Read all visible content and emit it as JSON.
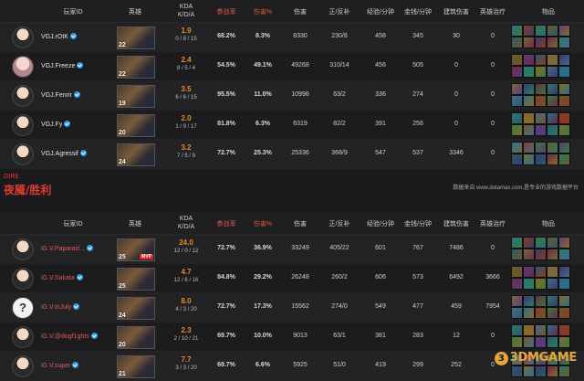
{
  "headers": {
    "player_id": "玩家ID",
    "hero": "英雄",
    "kda_top": "KDA",
    "kda_bottom": "K/D/A",
    "participation": "参战率",
    "damage_pct": "伤害%",
    "damage": "伤害",
    "last_hits": "正/反补",
    "xpm": "经验/分钟",
    "gpm": "金钱/分钟",
    "building_damage": "建筑伤害",
    "hero_healing": "英雄治疗",
    "items": "物品"
  },
  "radiant": {
    "players": [
      {
        "name": "VGJ.rOtK",
        "level": "22",
        "ratio": "1.9",
        "kda": "0 / 8 / 15",
        "participation": "68.2%",
        "damage_pct": "8.3%",
        "damage": "8330",
        "last_hits": "230/8",
        "xpm": "458",
        "gpm": "345",
        "building_damage": "30",
        "hero_healing": "0",
        "avatar": "player-photo-icon"
      },
      {
        "name": "VGJ.Freeze",
        "level": "22",
        "ratio": "2.4",
        "kda": "8 / 5 / 4",
        "participation": "54.5%",
        "damage_pct": "49.1%",
        "damage": "49268",
        "last_hits": "310/14",
        "xpm": "456",
        "gpm": "505",
        "building_damage": "0",
        "hero_healing": "0",
        "avatar": "player-photo-icon"
      },
      {
        "name": "VGJ.Fenrir",
        "level": "19",
        "ratio": "3.5",
        "kda": "6 / 6 / 15",
        "participation": "95.5%",
        "damage_pct": "11.0%",
        "damage": "10998",
        "last_hits": "63/2",
        "xpm": "336",
        "gpm": "274",
        "building_damage": "0",
        "hero_healing": "0",
        "avatar": "player-photo-icon"
      },
      {
        "name": "VGJ.Fy",
        "level": "20",
        "ratio": "2.0",
        "kda": "1 / 9 / 17",
        "participation": "81.8%",
        "damage_pct": "6.3%",
        "damage": "6319",
        "last_hits": "82/2",
        "xpm": "391",
        "gpm": "256",
        "building_damage": "0",
        "hero_healing": "0",
        "avatar": "player-photo-icon"
      },
      {
        "name": "VGJ.Agressif",
        "level": "24",
        "ratio": "3.2",
        "kda": "7 / 5 / 9",
        "participation": "72.7%",
        "damage_pct": "25.3%",
        "damage": "25336",
        "last_hits": "368/9",
        "xpm": "547",
        "gpm": "537",
        "building_damage": "3346",
        "hero_healing": "0",
        "avatar": "player-photo-icon"
      }
    ]
  },
  "dire_label": "DIRE",
  "dire_result": "夜魇/胜利",
  "source_note": "数据来自 www.dotamax.com,是专业的游戏数据平台",
  "dire": {
    "players": [
      {
        "name": "iG.V.Paparazi...",
        "level": "25",
        "ratio": "24.0",
        "kda": "12 / 0 / 12",
        "participation": "72.7%",
        "damage_pct": "36.9%",
        "damage": "33249",
        "last_hits": "405/22",
        "xpm": "601",
        "gpm": "767",
        "building_damage": "7486",
        "hero_healing": "0",
        "mvp": "MVP",
        "avatar": "player-photo-icon"
      },
      {
        "name": "iG.V.Sakata",
        "level": "25",
        "ratio": "4.7",
        "kda": "12 / 6 / 16",
        "participation": "84.8%",
        "damage_pct": "29.2%",
        "damage": "26248",
        "last_hits": "260/2",
        "xpm": "606",
        "gpm": "573",
        "building_damage": "6492",
        "hero_healing": "3666",
        "avatar": "player-photo-icon"
      },
      {
        "name": "iG.V.InJuly",
        "level": "24",
        "ratio": "8.0",
        "kda": "4 / 3 / 20",
        "participation": "72.7%",
        "damage_pct": "17.3%",
        "damage": "15562",
        "last_hits": "274/0",
        "xpm": "549",
        "gpm": "477",
        "building_damage": "459",
        "hero_healing": "7954",
        "avatar": "question-mark-icon"
      },
      {
        "name": "iG.V.@dogf1ghts",
        "level": "20",
        "ratio": "2.3",
        "kda": "2 / 10 / 21",
        "participation": "69.7%",
        "damage_pct": "10.0%",
        "damage": "9013",
        "last_hits": "63/1",
        "xpm": "381",
        "gpm": "283",
        "building_damage": "12",
        "hero_healing": "0",
        "avatar": "player-photo-icon"
      },
      {
        "name": "iG.V.super",
        "level": "21",
        "ratio": "7.7",
        "kda": "3 / 3 / 20",
        "participation": "69.7%",
        "damage_pct": "6.6%",
        "damage": "5925",
        "last_hits": "51/0",
        "xpm": "419",
        "gpm": "299",
        "building_damage": "252",
        "hero_healing": "0",
        "avatar": "player-photo-icon"
      }
    ]
  },
  "watermark": "3DMGAME",
  "colors": {
    "accent_orange": "#e9882b",
    "dire_red": "#e03b30",
    "verified_blue": "#2f9de2",
    "background": "#1b1b1d"
  }
}
